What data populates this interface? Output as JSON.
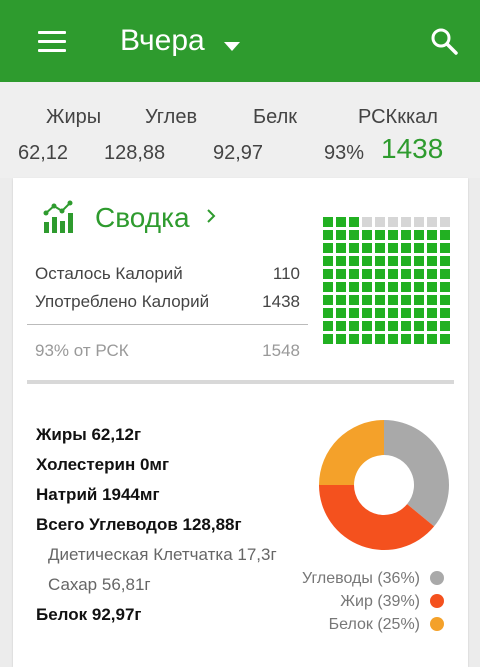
{
  "appbar": {
    "title": "Вчера"
  },
  "macros": {
    "fat_label": "Жиры",
    "fat_value": "62,12",
    "carbs_label": "Углев",
    "carbs_value": "128,88",
    "protein_label": "Белк",
    "protein_value": "92,97",
    "rsk_label": "РСКккал",
    "rsk_percent": "93%",
    "calories": "1438"
  },
  "summary": {
    "title": "Сводка",
    "remaining_label": "Осталось Калорий",
    "remaining_value": "110",
    "consumed_label": "Употреблено Калорий",
    "consumed_value": "1438",
    "rsk_label": "93% от РСК",
    "rsk_value": "1548",
    "grid": {
      "total": 100,
      "filled": 93,
      "filled_color": "#22b022",
      "empty_color": "#d6d6d6"
    }
  },
  "nutrients": [
    {
      "label": "Жиры 62,12г",
      "sub": false
    },
    {
      "label": "Холестерин 0мг",
      "sub": false
    },
    {
      "label": "Натрий 1944мг",
      "sub": false
    },
    {
      "label": "Всего Углеводов 128,88г",
      "sub": false
    },
    {
      "label": "Диетическая Клетчатка 17,3г",
      "sub": true
    },
    {
      "label": "Сахар 56,81г",
      "sub": true
    },
    {
      "label": "Белок 92,97г",
      "sub": false
    }
  ],
  "chart_data": {
    "type": "pie",
    "categories": [
      "Углеводы",
      "Жир",
      "Белок"
    ],
    "values": [
      36,
      39,
      25
    ],
    "labels": [
      "Углеводы (36%)",
      "Жир (39%)",
      "Белок (25%)"
    ],
    "colors": [
      "#a9a9a9",
      "#f4511e",
      "#f4a12a"
    ]
  }
}
